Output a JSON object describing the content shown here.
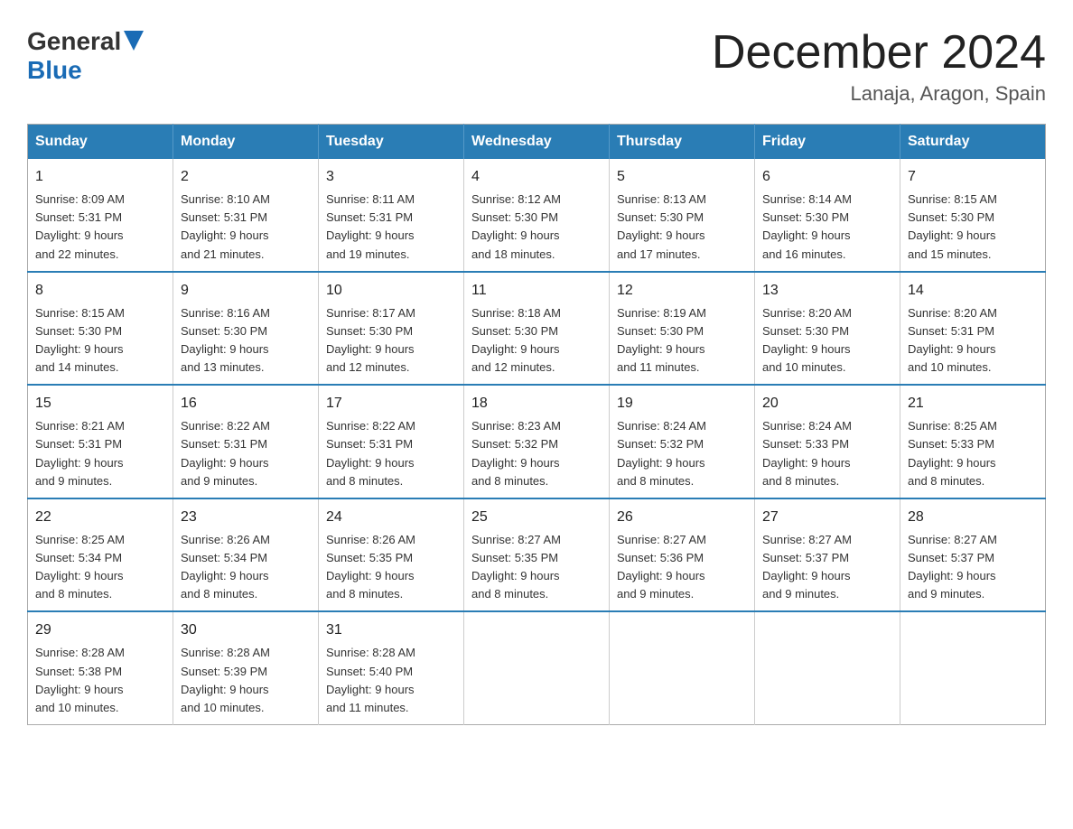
{
  "header": {
    "logo_general": "General",
    "logo_blue": "Blue",
    "month_title": "December 2024",
    "location": "Lanaja, Aragon, Spain"
  },
  "weekdays": [
    "Sunday",
    "Monday",
    "Tuesday",
    "Wednesday",
    "Thursday",
    "Friday",
    "Saturday"
  ],
  "weeks": [
    [
      {
        "day": "1",
        "sunrise": "8:09 AM",
        "sunset": "5:31 PM",
        "daylight": "9 hours and 22 minutes."
      },
      {
        "day": "2",
        "sunrise": "8:10 AM",
        "sunset": "5:31 PM",
        "daylight": "9 hours and 21 minutes."
      },
      {
        "day": "3",
        "sunrise": "8:11 AM",
        "sunset": "5:31 PM",
        "daylight": "9 hours and 19 minutes."
      },
      {
        "day": "4",
        "sunrise": "8:12 AM",
        "sunset": "5:30 PM",
        "daylight": "9 hours and 18 minutes."
      },
      {
        "day": "5",
        "sunrise": "8:13 AM",
        "sunset": "5:30 PM",
        "daylight": "9 hours and 17 minutes."
      },
      {
        "day": "6",
        "sunrise": "8:14 AM",
        "sunset": "5:30 PM",
        "daylight": "9 hours and 16 minutes."
      },
      {
        "day": "7",
        "sunrise": "8:15 AM",
        "sunset": "5:30 PM",
        "daylight": "9 hours and 15 minutes."
      }
    ],
    [
      {
        "day": "8",
        "sunrise": "8:15 AM",
        "sunset": "5:30 PM",
        "daylight": "9 hours and 14 minutes."
      },
      {
        "day": "9",
        "sunrise": "8:16 AM",
        "sunset": "5:30 PM",
        "daylight": "9 hours and 13 minutes."
      },
      {
        "day": "10",
        "sunrise": "8:17 AM",
        "sunset": "5:30 PM",
        "daylight": "9 hours and 12 minutes."
      },
      {
        "day": "11",
        "sunrise": "8:18 AM",
        "sunset": "5:30 PM",
        "daylight": "9 hours and 12 minutes."
      },
      {
        "day": "12",
        "sunrise": "8:19 AM",
        "sunset": "5:30 PM",
        "daylight": "9 hours and 11 minutes."
      },
      {
        "day": "13",
        "sunrise": "8:20 AM",
        "sunset": "5:30 PM",
        "daylight": "9 hours and 10 minutes."
      },
      {
        "day": "14",
        "sunrise": "8:20 AM",
        "sunset": "5:31 PM",
        "daylight": "9 hours and 10 minutes."
      }
    ],
    [
      {
        "day": "15",
        "sunrise": "8:21 AM",
        "sunset": "5:31 PM",
        "daylight": "9 hours and 9 minutes."
      },
      {
        "day": "16",
        "sunrise": "8:22 AM",
        "sunset": "5:31 PM",
        "daylight": "9 hours and 9 minutes."
      },
      {
        "day": "17",
        "sunrise": "8:22 AM",
        "sunset": "5:31 PM",
        "daylight": "9 hours and 8 minutes."
      },
      {
        "day": "18",
        "sunrise": "8:23 AM",
        "sunset": "5:32 PM",
        "daylight": "9 hours and 8 minutes."
      },
      {
        "day": "19",
        "sunrise": "8:24 AM",
        "sunset": "5:32 PM",
        "daylight": "9 hours and 8 minutes."
      },
      {
        "day": "20",
        "sunrise": "8:24 AM",
        "sunset": "5:33 PM",
        "daylight": "9 hours and 8 minutes."
      },
      {
        "day": "21",
        "sunrise": "8:25 AM",
        "sunset": "5:33 PM",
        "daylight": "9 hours and 8 minutes."
      }
    ],
    [
      {
        "day": "22",
        "sunrise": "8:25 AM",
        "sunset": "5:34 PM",
        "daylight": "9 hours and 8 minutes."
      },
      {
        "day": "23",
        "sunrise": "8:26 AM",
        "sunset": "5:34 PM",
        "daylight": "9 hours and 8 minutes."
      },
      {
        "day": "24",
        "sunrise": "8:26 AM",
        "sunset": "5:35 PM",
        "daylight": "9 hours and 8 minutes."
      },
      {
        "day": "25",
        "sunrise": "8:27 AM",
        "sunset": "5:35 PM",
        "daylight": "9 hours and 8 minutes."
      },
      {
        "day": "26",
        "sunrise": "8:27 AM",
        "sunset": "5:36 PM",
        "daylight": "9 hours and 9 minutes."
      },
      {
        "day": "27",
        "sunrise": "8:27 AM",
        "sunset": "5:37 PM",
        "daylight": "9 hours and 9 minutes."
      },
      {
        "day": "28",
        "sunrise": "8:27 AM",
        "sunset": "5:37 PM",
        "daylight": "9 hours and 9 minutes."
      }
    ],
    [
      {
        "day": "29",
        "sunrise": "8:28 AM",
        "sunset": "5:38 PM",
        "daylight": "9 hours and 10 minutes."
      },
      {
        "day": "30",
        "sunrise": "8:28 AM",
        "sunset": "5:39 PM",
        "daylight": "9 hours and 10 minutes."
      },
      {
        "day": "31",
        "sunrise": "8:28 AM",
        "sunset": "5:40 PM",
        "daylight": "9 hours and 11 minutes."
      },
      null,
      null,
      null,
      null
    ]
  ]
}
